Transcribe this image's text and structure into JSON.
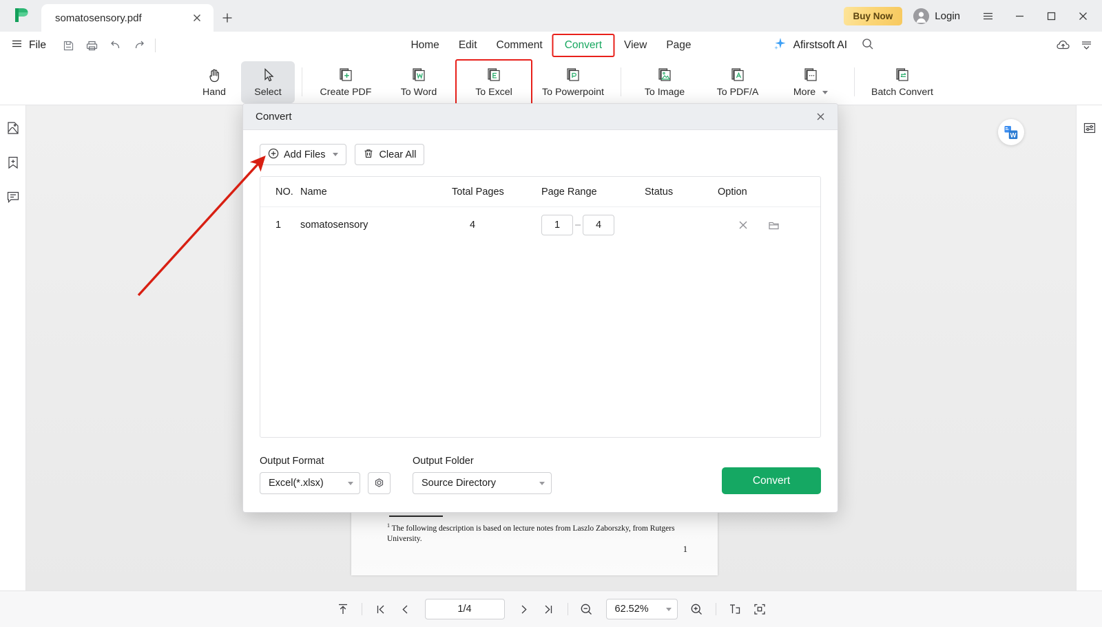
{
  "app": {
    "logo_icon": "afirstsoft-logo-icon"
  },
  "titlebar": {
    "tab_title": "somatosensory.pdf",
    "tab_close_icon": "close-icon",
    "new_tab_icon": "plus-icon",
    "buy_now_label": "Buy Now",
    "login_label": "Login",
    "avatar_icon": "user-avatar-icon",
    "hamburger_icon": "hamburger-menu-icon",
    "minimize_icon": "minimize-icon",
    "maximize_icon": "maximize-icon",
    "close_icon": "window-close-icon"
  },
  "menubar": {
    "file_label": "File",
    "file_icon": "hamburger-menu-icon",
    "quick_tools": [
      {
        "name": "save-icon"
      },
      {
        "name": "print-icon"
      },
      {
        "name": "undo-icon"
      },
      {
        "name": "redo-icon"
      }
    ],
    "items": [
      {
        "label": "Home",
        "active": false
      },
      {
        "label": "Edit",
        "active": false
      },
      {
        "label": "Comment",
        "active": false
      },
      {
        "label": "Convert",
        "active": true,
        "highlighted": true
      },
      {
        "label": "View",
        "active": false
      },
      {
        "label": "Page",
        "active": false
      }
    ],
    "ai_label": "Afirstsoft AI",
    "ai_icon": "sparkle-icon",
    "search_icon": "search-icon",
    "cloud_upload_icon": "cloud-upload-icon",
    "collapse_icon": "collapse-ribbon-icon"
  },
  "ribbon": {
    "tools": [
      {
        "label": "Hand",
        "icon": "hand-icon",
        "selected": false,
        "highlighted": false
      },
      {
        "label": "Select",
        "icon": "cursor-select-icon",
        "selected": true,
        "highlighted": false
      },
      {
        "label": "Create PDF",
        "icon": "create-pdf-icon",
        "selected": false,
        "highlighted": false
      },
      {
        "label": "To Word",
        "icon": "to-word-icon",
        "selected": false,
        "highlighted": false
      },
      {
        "label": "To Excel",
        "icon": "to-excel-icon",
        "selected": false,
        "highlighted": true
      },
      {
        "label": "To Powerpoint",
        "icon": "to-powerpoint-icon",
        "selected": false,
        "highlighted": false
      },
      {
        "label": "To Image",
        "icon": "to-image-icon",
        "selected": false,
        "highlighted": false
      },
      {
        "label": "To PDF/A",
        "icon": "to-pdfa-icon",
        "selected": false,
        "highlighted": false
      },
      {
        "label": "More",
        "icon": "more-icon",
        "selected": false,
        "highlighted": false,
        "has_caret": true
      },
      {
        "label": "Batch Convert",
        "icon": "batch-convert-icon",
        "selected": false,
        "highlighted": false
      }
    ]
  },
  "left_rail": {
    "items": [
      {
        "name": "thumbnails-icon"
      },
      {
        "name": "bookmark-add-icon"
      },
      {
        "name": "comments-icon"
      }
    ]
  },
  "right_rail": {
    "items": [
      {
        "name": "properties-panel-icon"
      }
    ],
    "float_word_icon": "word-convert-floating-icon"
  },
  "document": {
    "footnote_marker": "1",
    "footnote_text": "The following description is based on lecture notes from Laszlo Zaborszky, from Rutgers University.",
    "page_number": "1"
  },
  "modal": {
    "title": "Convert",
    "close_icon": "close-icon",
    "add_files_label": "Add Files",
    "add_files_icon": "plus-circle-icon",
    "clear_all_label": "Clear All",
    "clear_all_icon": "trash-icon",
    "table": {
      "columns": [
        "NO.",
        "Name",
        "Total Pages",
        "Page Range",
        "Status",
        "Option"
      ],
      "rows": [
        {
          "no": "1",
          "name": "somatosensory",
          "total_pages": "4",
          "page_range_from": "1",
          "page_range_sep": "–",
          "page_range_to": "4",
          "status": "",
          "remove_icon": "remove-file-icon",
          "folder_icon": "open-folder-icon"
        }
      ]
    },
    "output_format_label": "Output Format",
    "output_format_value": "Excel(*.xlsx)",
    "settings_icon": "settings-gear-icon",
    "output_folder_label": "Output Folder",
    "output_folder_value": "Source Directory",
    "convert_button_label": "Convert"
  },
  "bottombar": {
    "scroll_top_icon": "scroll-to-top-icon",
    "first_page_icon": "first-page-icon",
    "prev_page_icon": "previous-page-icon",
    "page_indicator": "1/4",
    "next_page_icon": "next-page-icon",
    "last_page_icon": "last-page-icon",
    "zoom_out_icon": "zoom-out-icon",
    "zoom_value": "62.52%",
    "zoom_in_icon": "zoom-in-icon",
    "fit_width_icon": "fit-width-icon",
    "fit_page_icon": "fit-page-icon"
  },
  "annotations": {
    "arrow_color": "#d81f12",
    "highlight_box_color": "#e8201a"
  },
  "colors": {
    "accent_green": "#15a863",
    "buy_now_gold": "#f7c95f",
    "annotation_red": "#e8201a"
  }
}
